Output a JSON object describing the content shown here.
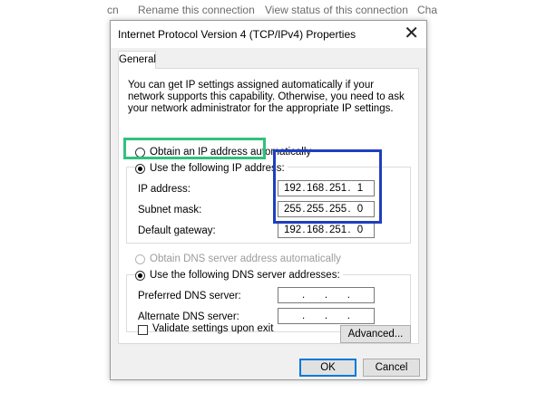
{
  "background": {
    "items": [
      "cn",
      "Rename this connection",
      "View status of this connection",
      "Cha"
    ]
  },
  "dialog": {
    "title": "Internet Protocol Version 4 (TCP/IPv4) Properties",
    "close_glyph": "✕",
    "tab": "General",
    "intro": "You can get IP settings assigned automatically if your network supports this capability. Otherwise, you need to ask your network administrator for the appropriate IP settings.",
    "ip_mode": {
      "auto_label": "Obtain an IP address automatically",
      "manual_label": "Use the following IP address:",
      "selected": "manual"
    },
    "ip_fields": [
      {
        "label": "IP address:",
        "octets": [
          "192",
          "168",
          "251",
          "1"
        ]
      },
      {
        "label": "Subnet mask:",
        "octets": [
          "255",
          "255",
          "255",
          "0"
        ]
      },
      {
        "label": "Default gateway:",
        "octets": [
          "192",
          "168",
          "251",
          "0"
        ]
      }
    ],
    "dns_mode": {
      "auto_label": "Obtain DNS server address automatically",
      "manual_label": "Use the following DNS server addresses:",
      "selected": "manual",
      "auto_disabled": true
    },
    "dns_fields": [
      {
        "label": "Preferred DNS server:",
        "octets": [
          "",
          "",
          "",
          ""
        ]
      },
      {
        "label": "Alternate DNS server:",
        "octets": [
          "",
          "",
          "",
          ""
        ]
      }
    ],
    "validate_label": "Validate settings upon exit",
    "validate_checked": false,
    "advanced_button": "Advanced...",
    "ok_button": "OK",
    "cancel_button": "Cancel"
  },
  "highlight_colors": {
    "green": "#2ec27e",
    "blue": "#1f3fbf"
  }
}
